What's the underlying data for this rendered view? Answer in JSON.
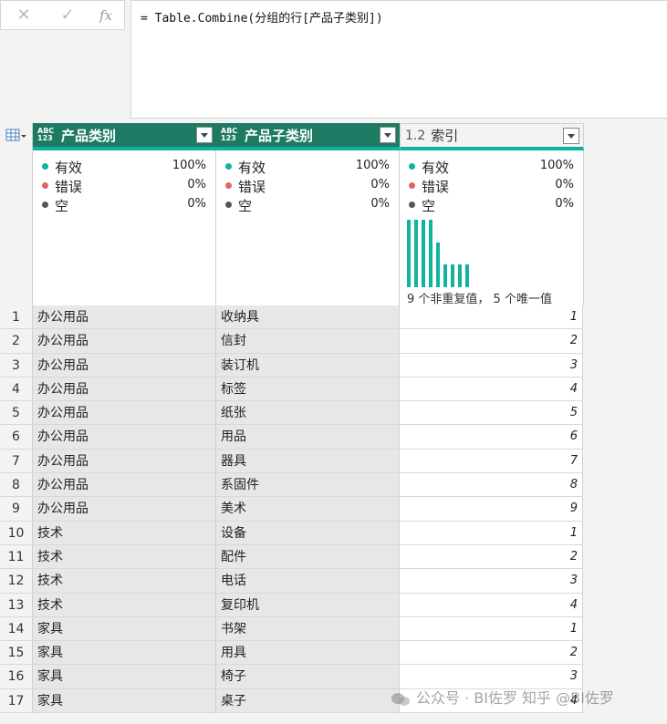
{
  "formula_bar": {
    "cancel_icon": "close-icon",
    "confirm_icon": "check-icon",
    "fx_label": "fx",
    "formula": "= Table.Combine(分组的行[产品子类别])"
  },
  "columns": [
    {
      "type_top": "ABC",
      "type_bottom": "123",
      "title": "产品类别"
    },
    {
      "type_top": "ABC",
      "type_bottom": "123",
      "title": "产品子类别"
    },
    {
      "type_label": "1.2",
      "title": "索引"
    }
  ],
  "profile": {
    "valid_label": "有效",
    "error_label": "错误",
    "empty_label": "空",
    "colors": {
      "valid": "#11b39e",
      "error": "#e06464",
      "empty": "#555555"
    },
    "values": [
      {
        "valid": "100%",
        "error": "0%",
        "empty": "0%"
      },
      {
        "valid": "100%",
        "error": "0%",
        "empty": "0%"
      },
      {
        "valid": "100%",
        "error": "0%",
        "empty": "0%"
      }
    ],
    "histogram": {
      "counts": [
        3,
        3,
        3,
        3,
        2,
        1,
        1,
        1,
        1
      ],
      "caption": "9 个非重复值，  5 个唯一值"
    }
  },
  "rows": [
    {
      "n": "1",
      "cat": "办公用品",
      "sub": "收纳具",
      "idx": "1"
    },
    {
      "n": "2",
      "cat": "办公用品",
      "sub": "信封",
      "idx": "2"
    },
    {
      "n": "3",
      "cat": "办公用品",
      "sub": "装订机",
      "idx": "3"
    },
    {
      "n": "4",
      "cat": "办公用品",
      "sub": "标签",
      "idx": "4"
    },
    {
      "n": "5",
      "cat": "办公用品",
      "sub": "纸张",
      "idx": "5"
    },
    {
      "n": "6",
      "cat": "办公用品",
      "sub": "用品",
      "idx": "6"
    },
    {
      "n": "7",
      "cat": "办公用品",
      "sub": "器具",
      "idx": "7"
    },
    {
      "n": "8",
      "cat": "办公用品",
      "sub": "系固件",
      "idx": "8"
    },
    {
      "n": "9",
      "cat": "办公用品",
      "sub": "美术",
      "idx": "9"
    },
    {
      "n": "10",
      "cat": "技术",
      "sub": "设备",
      "idx": "1"
    },
    {
      "n": "11",
      "cat": "技术",
      "sub": "配件",
      "idx": "2"
    },
    {
      "n": "12",
      "cat": "技术",
      "sub": "电话",
      "idx": "3"
    },
    {
      "n": "13",
      "cat": "技术",
      "sub": "复印机",
      "idx": "4"
    },
    {
      "n": "14",
      "cat": "家具",
      "sub": "书架",
      "idx": "1"
    },
    {
      "n": "15",
      "cat": "家具",
      "sub": "用具",
      "idx": "2"
    },
    {
      "n": "16",
      "cat": "家具",
      "sub": "椅子",
      "idx": "3"
    },
    {
      "n": "17",
      "cat": "家具",
      "sub": "桌子",
      "idx": "4"
    }
  ],
  "watermark": "公众号 · BI佐罗 知乎 @BI佐罗"
}
